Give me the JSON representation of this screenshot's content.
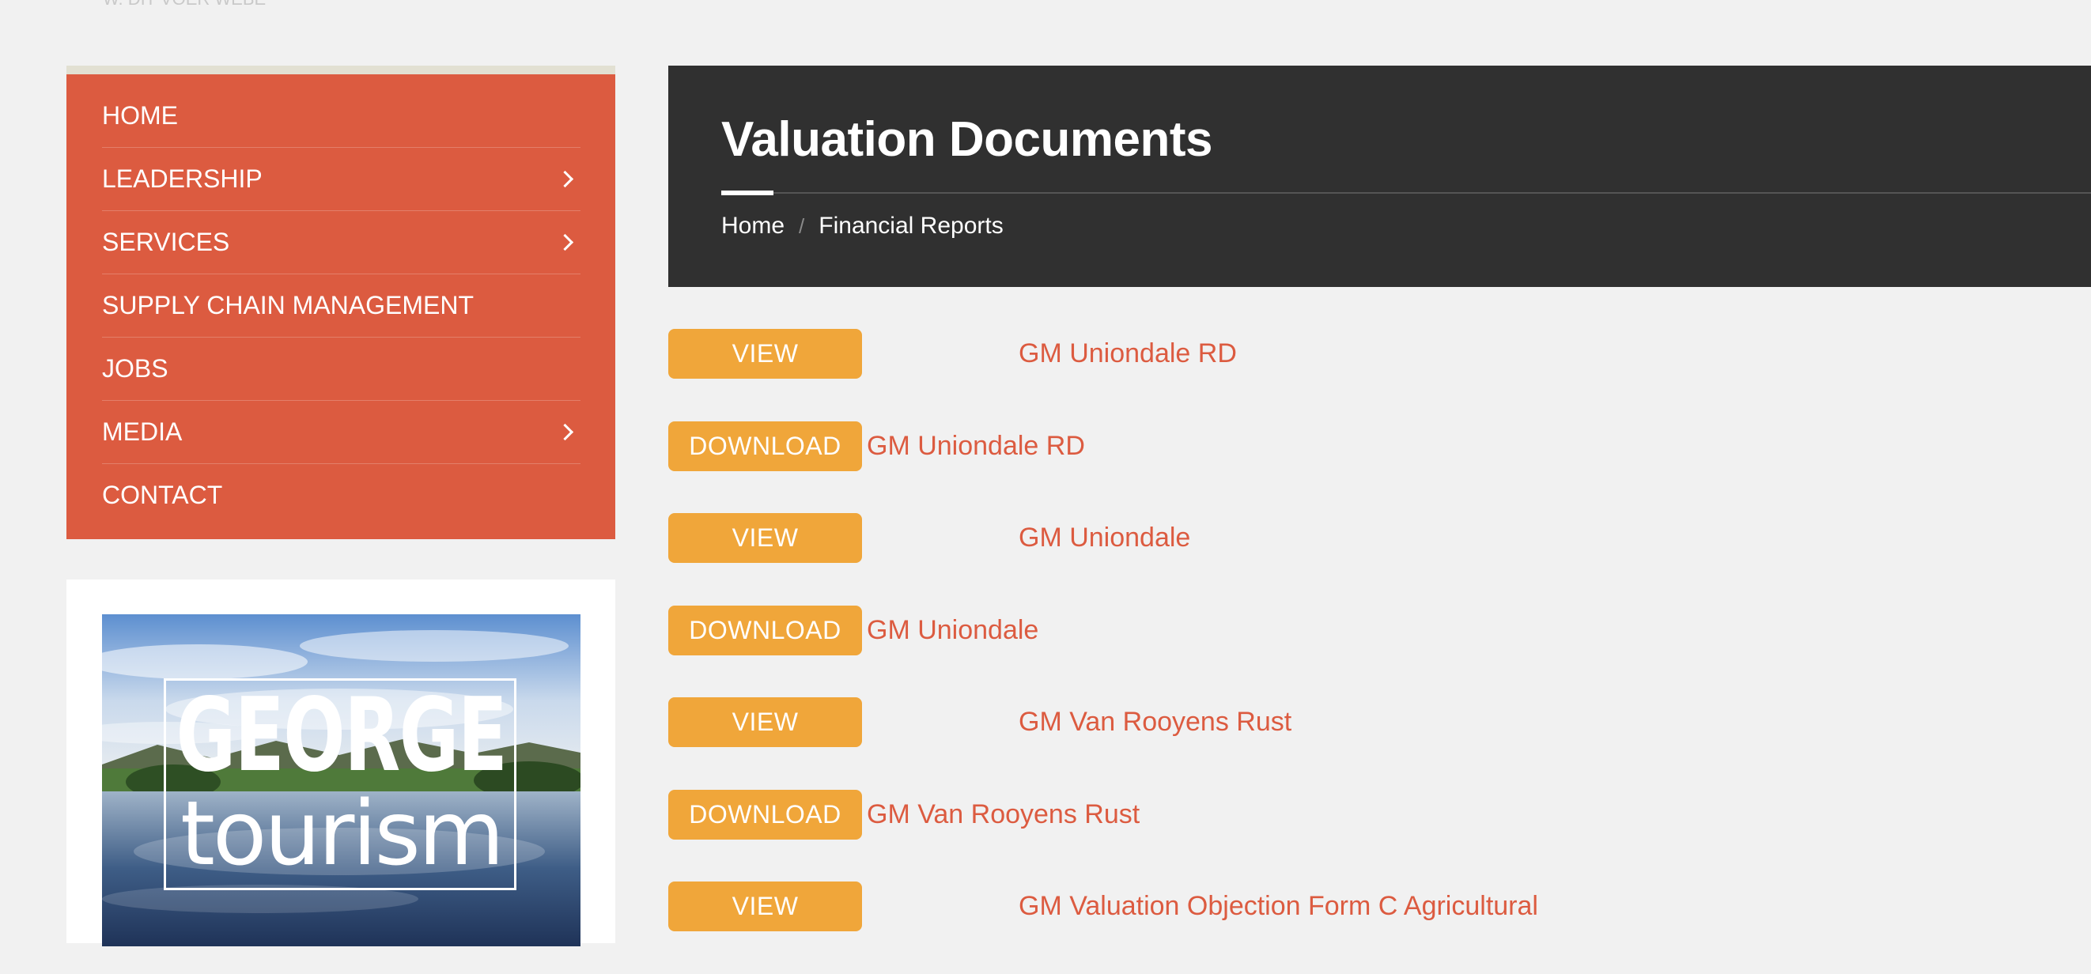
{
  "top_cut_text": "W. DIT VOER WEBE",
  "nav": {
    "items": [
      {
        "label": "HOME",
        "has_submenu": false
      },
      {
        "label": "LEADERSHIP",
        "has_submenu": true
      },
      {
        "label": "SERVICES",
        "has_submenu": true
      },
      {
        "label": "SUPPLY CHAIN MANAGEMENT",
        "has_submenu": false
      },
      {
        "label": "JOBS",
        "has_submenu": false
      },
      {
        "label": "MEDIA",
        "has_submenu": true
      },
      {
        "label": "CONTACT",
        "has_submenu": false
      }
    ]
  },
  "widget": {
    "george": "GEORGE",
    "tourism": "tourism"
  },
  "header": {
    "title": "Valuation Documents",
    "breadcrumb": {
      "home": "Home",
      "separator": "/",
      "current": "Financial Reports"
    }
  },
  "documents": [
    {
      "button": "VIEW",
      "kind": "view",
      "name": "GM Uniondale RD"
    },
    {
      "button": "DOWNLOAD",
      "kind": "download",
      "name": "GM Uniondale RD"
    },
    {
      "button": "VIEW",
      "kind": "view",
      "name": "GM Uniondale"
    },
    {
      "button": "DOWNLOAD",
      "kind": "download",
      "name": "GM Uniondale"
    },
    {
      "button": "VIEW",
      "kind": "view",
      "name": "GM Van Rooyens Rust"
    },
    {
      "button": "DOWNLOAD",
      "kind": "download",
      "name": "GM Van Rooyens Rust"
    },
    {
      "button": "VIEW",
      "kind": "view",
      "name": "GM Valuation Objection Form C Agricultural"
    }
  ],
  "colors": {
    "nav_bg": "#dc5b40",
    "header_bg": "#303030",
    "button_bg": "#f0a63a",
    "link": "#dc5b40",
    "page_bg": "#f1f1f1"
  }
}
